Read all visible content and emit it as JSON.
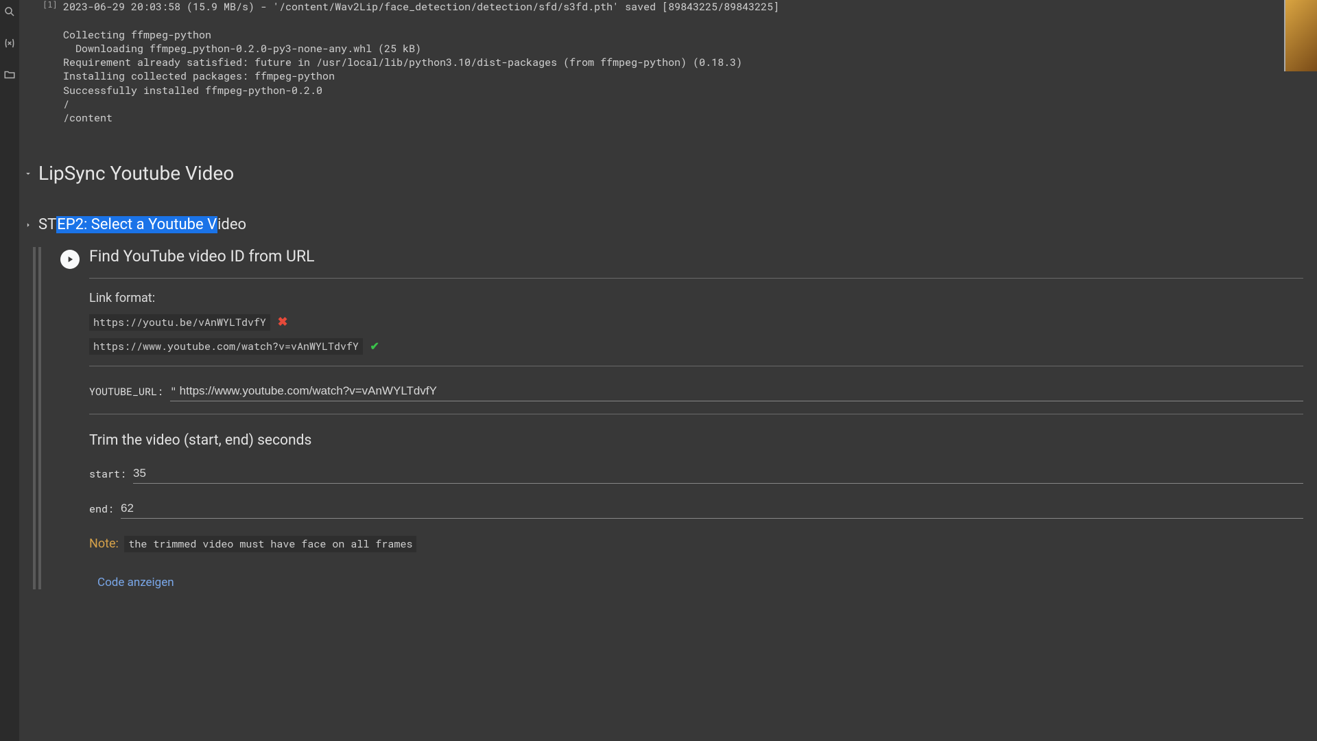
{
  "gutter_label": "[1]",
  "output_lines": "2023-06-29 20:03:58 (15.9 MB/s) - '/content/Wav2Lip/face_detection/detection/sfd/s3fd.pth' saved [89843225/89843225]\n\nCollecting ffmpeg-python\n  Downloading ffmpeg_python-0.2.0-py3-none-any.whl (25 kB)\nRequirement already satisfied: future in /usr/local/lib/python3.10/dist-packages (from ffmpeg-python) (0.18.3)\nInstalling collected packages: ffmpeg-python\nSuccessfully installed ffmpeg-python-0.2.0\n/\n/content",
  "section1": {
    "title": "LipSync Youtube Video"
  },
  "section2": {
    "prefix": "ST",
    "highlighted": "EP2: Select a Youtube V",
    "suffix": "ideo"
  },
  "cell": {
    "title": "Find YouTube video ID from URL",
    "link_format_label": "Link format:",
    "bad_url": "https://youtu.be/vAnWYLTdvfY",
    "good_url": "https://www.youtube.com/watch?v=vAnWYLTdvfY",
    "youtube_url_label": "YOUTUBE_URL:",
    "youtube_url_value": "https://www.youtube.com/watch?v=vAnWYLTdvfY",
    "trim_label": "Trim the video (start, end) seconds",
    "start_label": "start:",
    "start_value": "35",
    "end_label": "end:",
    "end_value": "62",
    "note_label": "Note:",
    "note_text": "the trimmed video must have face on all frames",
    "show_code": "Code anzeigen"
  }
}
